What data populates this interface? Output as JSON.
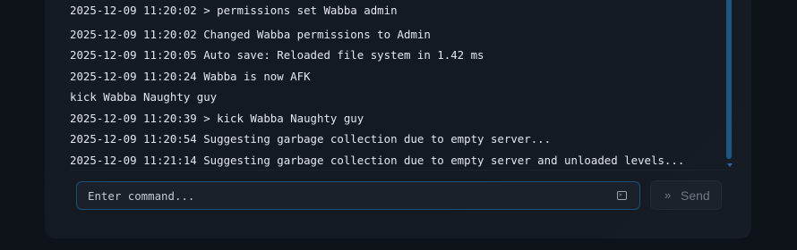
{
  "console": {
    "lines": [
      "2025-12-09 11:20:02 > permissions set Wabba admin",
      "2025-12-09 11:20:02 Changed Wabba permissions to Admin",
      "2025-12-09 11:20:05 Auto save: Reloaded file system in 1.42 ms",
      "2025-12-09 11:20:24 Wabba is now AFK",
      "kick Wabba Naughty guy",
      "2025-12-09 11:20:39 > kick Wabba Naughty guy",
      "2025-12-09 11:20:54 Suggesting garbage collection due to empty server...",
      "2025-12-09 11:21:14 Suggesting garbage collection due to empty server and unloaded levels..."
    ]
  },
  "command": {
    "placeholder": "Enter command...",
    "value": "",
    "icon": "terminal-icon"
  },
  "send": {
    "label": "Send",
    "icon": "chevrons-right-icon"
  },
  "colors": {
    "background": "#0e1319",
    "panel": "#151b23",
    "text": "#e3e7ec",
    "accent": "#1d5787",
    "input_border": "#1f4f75"
  }
}
